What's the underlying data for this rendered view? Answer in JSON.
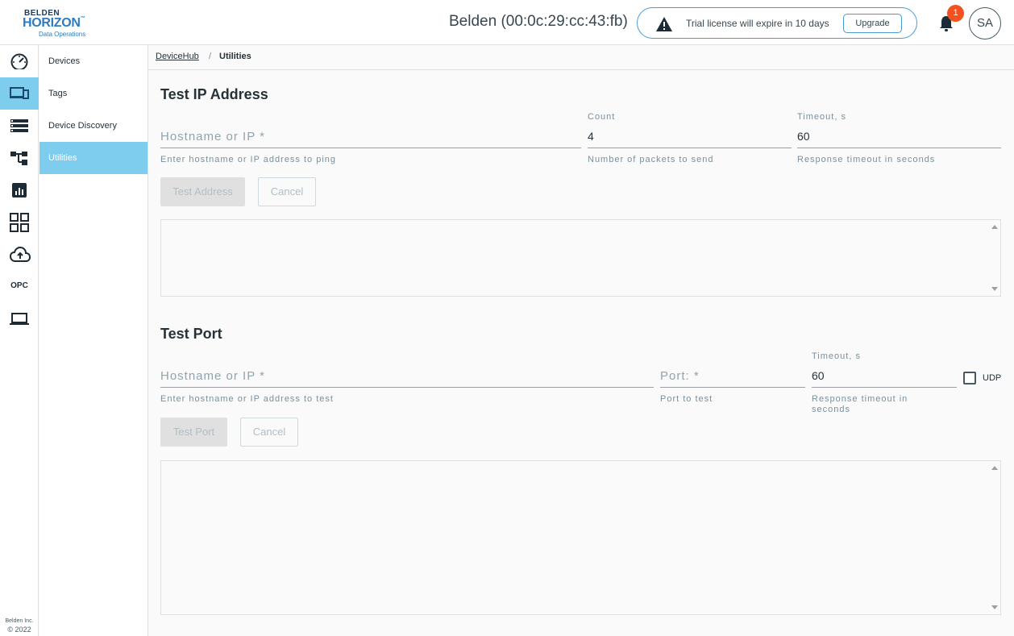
{
  "header": {
    "logo_line1": "BELDEN",
    "logo_line2": "HORIZON",
    "logo_tm": "™",
    "logo_line3": "Data Operations",
    "device_title": "Belden (00:0c:29:cc:43:fb)",
    "trial_text": "Trial license will expire in 10 days",
    "upgrade_label": "Upgrade",
    "notification_count": "1",
    "avatar_initials": "SA"
  },
  "rail": {
    "items": [
      {
        "icon": "dashboard-gauge-icon"
      },
      {
        "icon": "devices-icon"
      },
      {
        "icon": "list-icon"
      },
      {
        "icon": "hierarchy-icon"
      },
      {
        "icon": "report-chart-icon"
      },
      {
        "icon": "apps-grid-icon"
      },
      {
        "icon": "cloud-upload-icon"
      },
      {
        "label": "OPC"
      },
      {
        "icon": "laptop-icon"
      }
    ],
    "copyright_line1": "Belden Inc.",
    "copyright_line2": "© 2022"
  },
  "subnav": {
    "items": [
      "Devices",
      "Tags",
      "Device Discovery",
      "Utilities"
    ],
    "active": "Utilities"
  },
  "breadcrumb": {
    "root": "DeviceHub",
    "separator": "/",
    "current": "Utilities"
  },
  "test_ip": {
    "title": "Test IP Address",
    "host_placeholder": "Hostname or IP *",
    "host_hint": "Enter hostname or IP address to ping",
    "count_label": "Count",
    "count_value": "4",
    "count_hint": "Number of packets to send",
    "timeout_label": "Timeout, s",
    "timeout_value": "60",
    "timeout_hint": "Response timeout in seconds",
    "test_button": "Test Address",
    "cancel_button": "Cancel"
  },
  "test_port": {
    "title": "Test Port",
    "host_placeholder": "Hostname or IP *",
    "host_hint": "Enter hostname or IP address to test",
    "port_placeholder": "Port: *",
    "port_hint": "Port to test",
    "timeout_label": "Timeout, s",
    "timeout_value": "60",
    "timeout_hint": "Response timeout in seconds",
    "udp_label": "UDP",
    "udp_checked": false,
    "test_button": "Test Port",
    "cancel_button": "Cancel"
  },
  "colors": {
    "accent": "#7fcdee",
    "brand_dark": "#1c3a5f",
    "brand_blue": "#2e7bbf",
    "badge": "#f4511e"
  }
}
